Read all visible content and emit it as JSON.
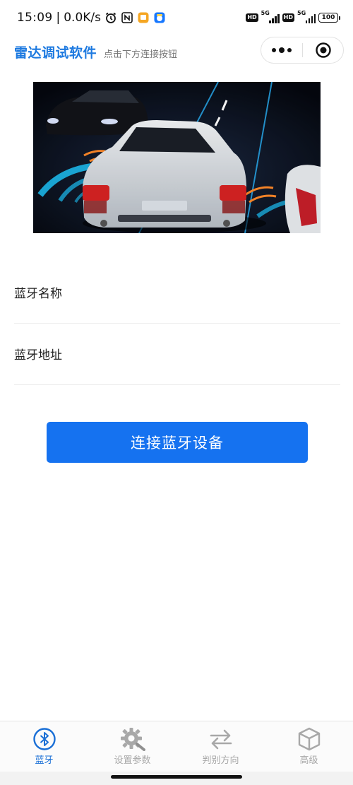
{
  "status_bar": {
    "time": "15:09",
    "separator": "|",
    "net_speed": "0.0K/s",
    "hd1": "HD",
    "net1": "5G",
    "hd2": "HD",
    "net2": "5G",
    "battery": "100",
    "icons": [
      "alarm-icon",
      "nfc-icon",
      "app-notification-icon",
      "app-notification-icon-2",
      "signal-icon",
      "battery-icon"
    ]
  },
  "header": {
    "title": "雷达调试软件",
    "subtitle": "点击下方连接按钮",
    "title_color": "#1e7ae0"
  },
  "banner": {
    "icon": "car-radar-banner-image"
  },
  "device": {
    "name_label": "蓝牙名称",
    "address_label": "蓝牙地址"
  },
  "actions": {
    "connect_label": "连接蓝牙设备",
    "connect_color": "#1572f0"
  },
  "tabbar": {
    "active_color": "#1a6fd6",
    "inactive_color": "#a8a8a8",
    "items": [
      {
        "label": "蓝牙",
        "icon": "bluetooth-icon",
        "active": true
      },
      {
        "label": "设置参数",
        "icon": "gear-icon",
        "active": false
      },
      {
        "label": "判别方向",
        "icon": "swap-arrows-icon",
        "active": false
      },
      {
        "label": "高级",
        "icon": "cube-icon",
        "active": false
      }
    ]
  }
}
